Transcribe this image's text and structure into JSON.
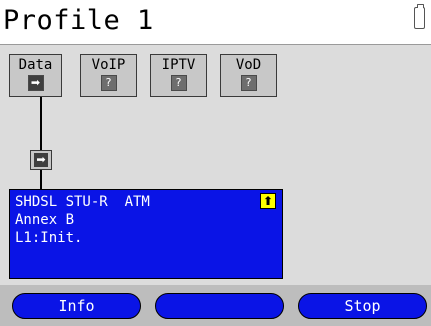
{
  "header": {
    "title": "Profile 1",
    "battery_icon": "battery-icon"
  },
  "services": [
    {
      "label": "Data",
      "icon": "arrow-right-icon",
      "icon_glyph": "➡",
      "active": true
    },
    {
      "label": "VoIP",
      "icon": "question-icon",
      "icon_glyph": "?",
      "active": false
    },
    {
      "label": "IPTV",
      "icon": "question-icon",
      "icon_glyph": "?",
      "active": false
    },
    {
      "label": "VoD",
      "icon": "question-icon",
      "icon_glyph": "?",
      "active": false
    }
  ],
  "connector": {
    "icon": "arrow-right-icon",
    "icon_glyph": "➡"
  },
  "port": {
    "line1": "SHDSL STU-R  ATM",
    "line2": "Annex B",
    "line3": "L1:Init.",
    "status_icon": "up-arrow-icon",
    "status_glyph": "⬆"
  },
  "softkeys": {
    "left": "Info",
    "middle": "",
    "right": "Stop"
  },
  "colors": {
    "accent": "#0a14e6",
    "highlight": "#ffff00",
    "panel": "#dcdcdc",
    "footer": "#bdbdbd"
  }
}
